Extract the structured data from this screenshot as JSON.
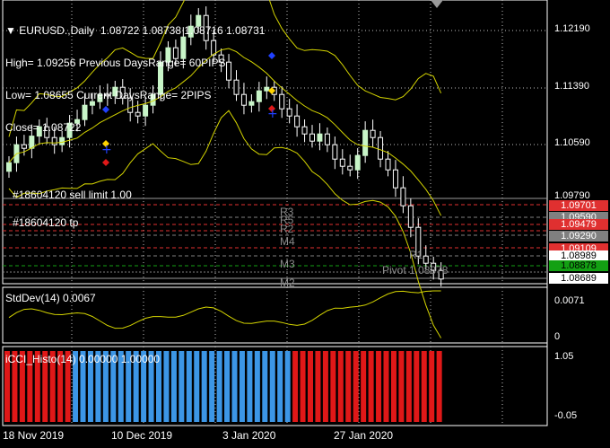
{
  "header": {
    "line1": "EURUSD.,Daily  1.08722 1.08738 1.08716 1.08731",
    "line2": "High= 1.09256 Previous DaysRange= 60PIPS",
    "line3": "Low= 1.08655 Current DaysRange= 2PIPS",
    "line4": "Close= 1.08722"
  },
  "orders": {
    "sell_limit": "#18604120 sell limit 1.00",
    "tp": "#18604120 tp"
  },
  "pivot_labels": {
    "r3": "R3",
    "r5": "R5",
    "r2": "R2",
    "m4": "M4",
    "m3": "M3",
    "r1": "R1",
    "pivot": "Pivot 1.08878",
    "m2": "M2"
  },
  "price_axis": {
    "ticks": [
      "1.12190",
      "1.11390",
      "1.10590",
      "1.09790"
    ],
    "labels": [
      {
        "text": "1.09701",
        "bg": "#e03030",
        "fg": "#ffffff"
      },
      {
        "text": "1.09590",
        "bg": "#808080",
        "fg": "#ffffff"
      },
      {
        "text": "1.09479",
        "bg": "#e03030",
        "fg": "#ffffff"
      },
      {
        "text": "1.09290",
        "bg": "#808080",
        "fg": "#ffffff"
      },
      {
        "text": "1.09109",
        "bg": "#e03030",
        "fg": "#ffffff"
      },
      {
        "text": "1.08989",
        "bg": "#ffffff",
        "fg": "#000000"
      },
      {
        "text": "1.08878",
        "bg": "#13a013",
        "fg": "#000000"
      },
      {
        "text": "1.08689",
        "bg": "#ffffff",
        "fg": "#000000"
      }
    ]
  },
  "stddev_pane": {
    "label": "StdDev(14) 0.0067",
    "tick_top": "0.0071",
    "tick_bottom": "0"
  },
  "cci_pane": {
    "label": "iCCI_Histo(14) 0.00000 1.00000",
    "tick_top": "1.05",
    "tick_bottom": "-0.05"
  },
  "time_axis": [
    "18 Nov 2019",
    "10 Dec 2019",
    "3 Jan 2020",
    "27 Jan 2020"
  ],
  "colors": {
    "bull_candle": "#c8f5c8",
    "bear_candle": "#ffffff",
    "bands": "#d4d400",
    "cci_red": "#e01818",
    "cci_blue": "#3c96e6",
    "grid": "#c0c0c0"
  },
  "chart_data": {
    "type": "candlestick",
    "title": "EURUSD.,Daily",
    "ylim": [
      1.0866,
      1.1258
    ],
    "price_ticks": [
      1.1219,
      1.1139,
      1.1059,
      1.0979
    ],
    "close_series_approx": [
      1.1035,
      1.106,
      1.1055,
      1.1072,
      1.1085,
      1.107,
      1.106,
      1.107,
      1.109,
      1.1095,
      1.1115,
      1.112,
      1.113,
      1.1128,
      1.114,
      1.1125,
      1.1105,
      1.11,
      1.1115,
      1.113,
      1.1175,
      1.1195,
      1.118,
      1.121,
      1.1225,
      1.124,
      1.1205,
      1.1185,
      1.1175,
      1.115,
      1.113,
      1.1115,
      1.112,
      1.1135,
      1.114,
      1.113,
      1.111,
      1.11,
      1.1085,
      1.1075,
      1.1065,
      1.1075,
      1.106,
      1.104,
      1.103,
      1.1025,
      1.1045,
      1.108,
      1.107,
      1.104,
      1.1025,
      1.1,
      1.0975,
      1.0945,
      1.0905,
      1.0895,
      1.0885,
      1.0873
    ]
  }
}
